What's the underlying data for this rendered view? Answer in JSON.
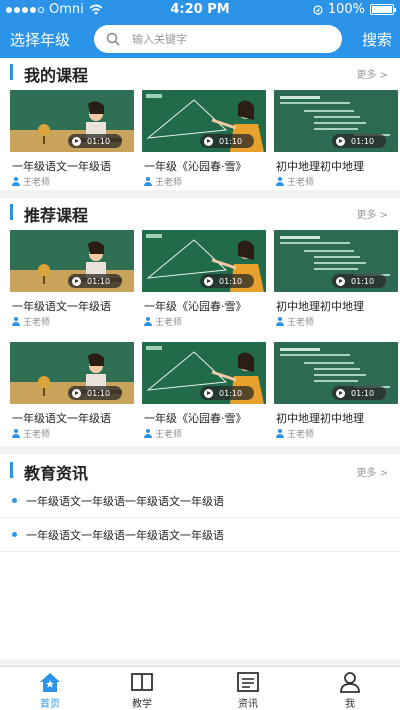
{
  "status_bar": {
    "carrier": "Omni",
    "time": "4:20 PM",
    "battery": "100%"
  },
  "header": {
    "grade_selector": "选择年级",
    "search_placeholder": "输入关键字",
    "search_button": "搜索"
  },
  "sections": {
    "my_courses": {
      "title": "我的课程",
      "more": "更多 >"
    },
    "recommended": {
      "title": "推荐课程",
      "more": "更多 >"
    },
    "news": {
      "title": "教育资讯",
      "more": "更多 >"
    }
  },
  "my_courses": [
    {
      "name": "一年级语文一年级语",
      "teacher": "王老师",
      "duration": "01:10"
    },
    {
      "name": "一年级《沁园春·雪》",
      "teacher": "王老师",
      "duration": "01:10"
    },
    {
      "name": "初中地理初中地理",
      "teacher": "王老师",
      "duration": "01:10"
    }
  ],
  "recommended_row1": [
    {
      "name": "一年级语文一年级语",
      "teacher": "王老师",
      "duration": "01:10"
    },
    {
      "name": "一年级《沁园春·雪》",
      "teacher": "王老师",
      "duration": "01:10"
    },
    {
      "name": "初中地理初中地理",
      "teacher": "王老师",
      "duration": "01:10"
    }
  ],
  "recommended_row2": [
    {
      "name": "一年级语文一年级语",
      "teacher": "王老师",
      "duration": "01:10"
    },
    {
      "name": "一年级《沁园春·雪》",
      "teacher": "王老师",
      "duration": "01:10"
    },
    {
      "name": "初中地理初中地理",
      "teacher": "王老师",
      "duration": "01:10"
    }
  ],
  "news": [
    {
      "text": "一年级语文一年级语一年级语文一年级语"
    },
    {
      "text": "一年级语文一年级语一年级语文一年级语"
    }
  ],
  "tabs": [
    {
      "label": "首页",
      "icon": "home-icon",
      "active": true
    },
    {
      "label": "教学",
      "icon": "book-icon",
      "active": false
    },
    {
      "label": "资讯",
      "icon": "news-icon",
      "active": false
    },
    {
      "label": "我",
      "icon": "user-icon",
      "active": false
    }
  ],
  "colors": {
    "primary": "#2b94e8",
    "board_green": "#1e6a45"
  }
}
